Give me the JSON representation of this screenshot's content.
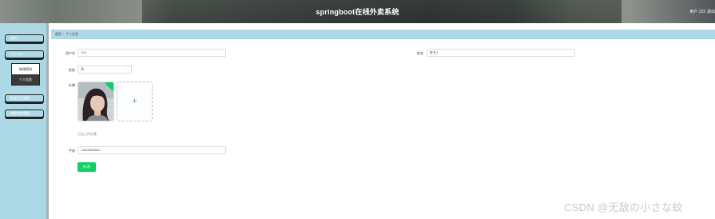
{
  "header": {
    "title": "springboot在线外卖系统",
    "user": "用户 123",
    "exit": "退出"
  },
  "sidebar": {
    "items": [
      {
        "label": "首页"
      },
      {
        "label": "个人中心",
        "submenu": [
          "修改密码",
          "个人信息"
        ]
      },
      {
        "label": "配送员工管理"
      },
      {
        "label": "商家审核管理"
      }
    ]
  },
  "breadcrumb": {
    "home": "首页",
    "current": "个人信息"
  },
  "form": {
    "username_label": "用户名",
    "username_value": "123",
    "name_label": "姓名",
    "name_value": "姓名1",
    "gender_label": "性别",
    "gender_value": "男",
    "avatar_label": "头像",
    "upload_plus": "+",
    "upload_hint": "点击上传头像",
    "phone_label": "手机",
    "phone_value": "13823888881",
    "submit_label": "修 改"
  },
  "watermark": "CSDN @无敌の小さな蚊"
}
